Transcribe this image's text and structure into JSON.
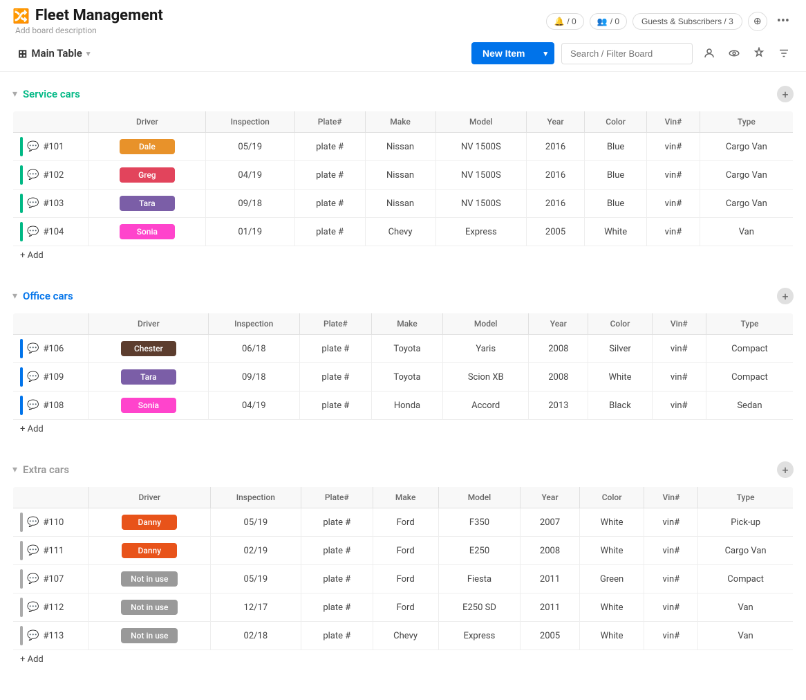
{
  "app": {
    "title": "Fleet Management",
    "subtitle": "Add board description",
    "title_icon": "🔀"
  },
  "header": {
    "activity_count": "/ 0",
    "notification_count": "/ 0",
    "guests_label": "Guests & Subscribers / 3",
    "more_icon": "•••"
  },
  "toolbar": {
    "main_table_label": "Main Table",
    "new_item_label": "New Item",
    "search_placeholder": "Search / Filter Board"
  },
  "groups": [
    {
      "id": "service_cars",
      "title": "Service cars",
      "color": "green",
      "columns": [
        "Driver",
        "Inspection",
        "Plate#",
        "Make",
        "Model",
        "Year",
        "Color",
        "Vin#",
        "Type"
      ],
      "rows": [
        {
          "id": "#101",
          "driver": "Dale",
          "driver_color": "driver-orange",
          "inspection": "05/19",
          "plate": "plate #",
          "make": "Nissan",
          "model": "NV 1500S",
          "year": "2016",
          "color": "Blue",
          "vin": "vin#",
          "type": "Cargo Van"
        },
        {
          "id": "#102",
          "driver": "Greg",
          "driver_color": "driver-red",
          "inspection": "04/19",
          "plate": "plate #",
          "make": "Nissan",
          "model": "NV 1500S",
          "year": "2016",
          "color": "Blue",
          "vin": "vin#",
          "type": "Cargo Van"
        },
        {
          "id": "#103",
          "driver": "Tara",
          "driver_color": "driver-purple",
          "inspection": "09/18",
          "plate": "plate #",
          "make": "Nissan",
          "model": "NV 1500S",
          "year": "2016",
          "color": "Blue",
          "vin": "vin#",
          "type": "Cargo Van"
        },
        {
          "id": "#104",
          "driver": "Sonia",
          "driver_color": "driver-pink",
          "inspection": "01/19",
          "plate": "plate #",
          "make": "Chevy",
          "model": "Express",
          "year": "2005",
          "color": "White",
          "vin": "vin#",
          "type": "Van"
        }
      ],
      "add_label": "+ Add"
    },
    {
      "id": "office_cars",
      "title": "Office cars",
      "color": "blue",
      "columns": [
        "Driver",
        "Inspection",
        "Plate#",
        "Make",
        "Model",
        "Year",
        "Color",
        "Vin#",
        "Type"
      ],
      "rows": [
        {
          "id": "#106",
          "driver": "Chester",
          "driver_color": "driver-brown",
          "inspection": "06/18",
          "plate": "plate #",
          "make": "Toyota",
          "model": "Yaris",
          "year": "2008",
          "color": "Silver",
          "vin": "vin#",
          "type": "Compact"
        },
        {
          "id": "#109",
          "driver": "Tara",
          "driver_color": "driver-purple",
          "inspection": "09/18",
          "plate": "plate #",
          "make": "Toyota",
          "model": "Scion XB",
          "year": "2008",
          "color": "White",
          "vin": "vin#",
          "type": "Compact"
        },
        {
          "id": "#108",
          "driver": "Sonia",
          "driver_color": "driver-pink",
          "inspection": "04/19",
          "plate": "plate #",
          "make": "Honda",
          "model": "Accord",
          "year": "2013",
          "color": "Black",
          "vin": "vin#",
          "type": "Sedan"
        }
      ],
      "add_label": "+ Add"
    },
    {
      "id": "extra_cars",
      "title": "Extra cars",
      "color": "gray",
      "columns": [
        "Driver",
        "Inspection",
        "Plate#",
        "Make",
        "Model",
        "Year",
        "Color",
        "Vin#",
        "Type"
      ],
      "rows": [
        {
          "id": "#110",
          "driver": "Danny",
          "driver_color": "driver-orange2",
          "inspection": "05/19",
          "plate": "plate #",
          "make": "Ford",
          "model": "F350",
          "year": "2007",
          "color": "White",
          "vin": "vin#",
          "type": "Pick-up"
        },
        {
          "id": "#111",
          "driver": "Danny",
          "driver_color": "driver-orange2",
          "inspection": "02/19",
          "plate": "plate #",
          "make": "Ford",
          "model": "E250",
          "year": "2008",
          "color": "White",
          "vin": "vin#",
          "type": "Cargo Van"
        },
        {
          "id": "#107",
          "driver": "Not in use",
          "driver_color": "driver-gray",
          "inspection": "05/19",
          "plate": "plate #",
          "make": "Ford",
          "model": "Fiesta",
          "year": "2011",
          "color": "Green",
          "vin": "vin#",
          "type": "Compact"
        },
        {
          "id": "#112",
          "driver": "Not in use",
          "driver_color": "driver-gray",
          "inspection": "12/17",
          "plate": "plate #",
          "make": "Ford",
          "model": "E250 SD",
          "year": "2011",
          "color": "White",
          "vin": "vin#",
          "type": "Van"
        },
        {
          "id": "#113",
          "driver": "Not in use",
          "driver_color": "driver-gray",
          "inspection": "02/18",
          "plate": "plate #",
          "make": "Chevy",
          "model": "Express",
          "year": "2005",
          "color": "White",
          "vin": "vin#",
          "type": "Van"
        }
      ],
      "add_label": "+ Add"
    }
  ]
}
